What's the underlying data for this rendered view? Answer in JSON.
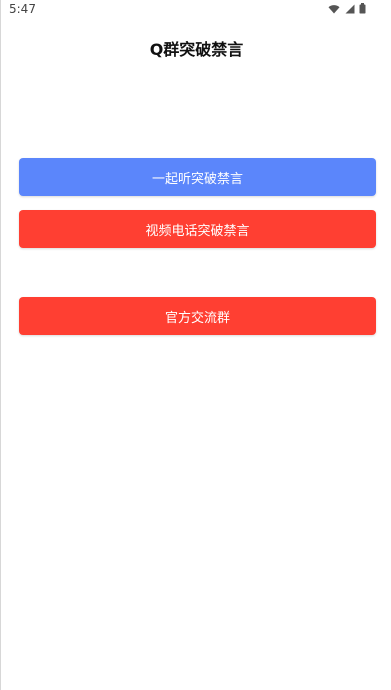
{
  "status_bar": {
    "time": "5:47",
    "icons": [
      "wifi-icon",
      "signal-icon",
      "battery-icon"
    ]
  },
  "header": {
    "title": "Q群突破禁言"
  },
  "actions": {
    "listen_together_label": "一起听突破禁言",
    "video_call_label": "视频电话突破禁言",
    "official_group_label": "官方交流群"
  },
  "colors": {
    "primary_blue": "#5b86fb",
    "danger_red": "#ff3f32"
  }
}
